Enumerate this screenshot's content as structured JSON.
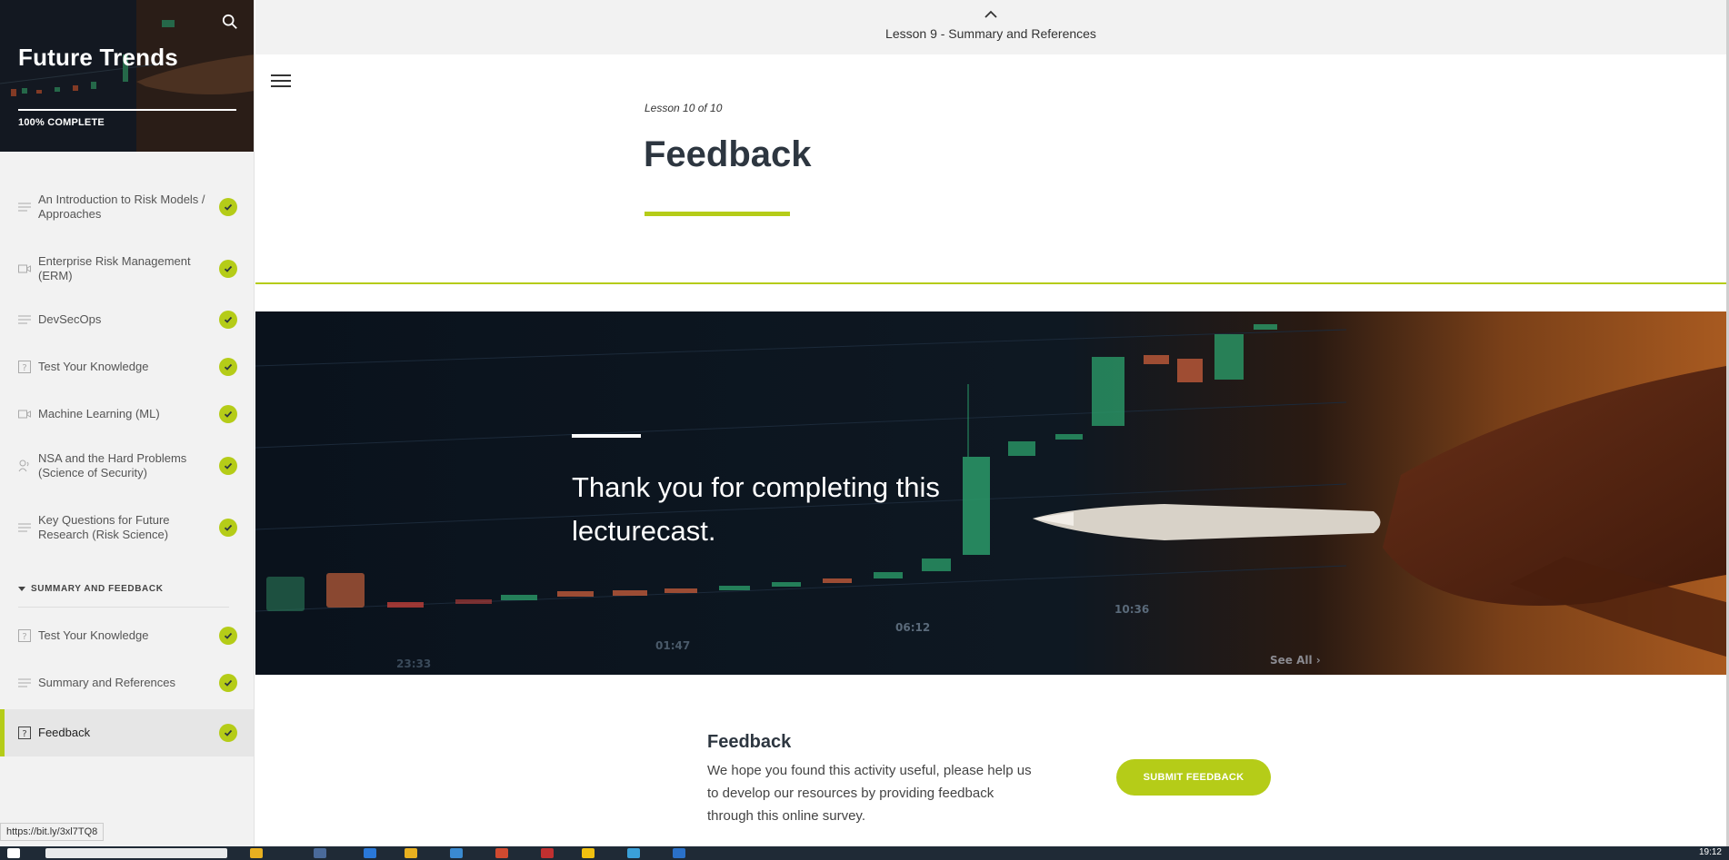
{
  "sidebar": {
    "course_title": "Future Trends",
    "progress_label": "100% COMPLETE",
    "progress_value": 1.0,
    "section_label": "SUMMARY AND FEEDBACK",
    "lessons": [
      {
        "label": "An Introduction to Risk Models / Approaches",
        "icon": "text-lines-icon",
        "complete": true
      },
      {
        "label": "Enterprise Risk Management (ERM)",
        "icon": "video-icon",
        "complete": true
      },
      {
        "label": "DevSecOps",
        "icon": "text-lines-icon",
        "complete": true
      },
      {
        "label": "Test Your Knowledge",
        "icon": "quiz-icon",
        "complete": true
      },
      {
        "label": "Machine Learning (ML)",
        "icon": "video-icon",
        "complete": true
      },
      {
        "label": "NSA and the Hard Problems (Science of Security)",
        "icon": "audio-icon",
        "complete": true
      },
      {
        "label": "Key Questions for Future Research (Risk Science)",
        "icon": "text-lines-icon",
        "complete": true
      }
    ],
    "section_lessons": [
      {
        "label": "Test Your Knowledge",
        "icon": "quiz-icon",
        "complete": true
      },
      {
        "label": "Summary and References",
        "icon": "text-lines-icon",
        "complete": true
      },
      {
        "label": "Feedback",
        "icon": "quiz-icon",
        "complete": true,
        "active": true
      }
    ]
  },
  "topbar": {
    "previous_lesson": "Lesson 9 - Summary and References"
  },
  "lesson": {
    "count": "Lesson 10 of 10",
    "title": "Feedback"
  },
  "hero": {
    "message": "Thank you for completing this lecturecast."
  },
  "feedback": {
    "title": "Feedback",
    "body": "We hope you found this activity useful, please help us to develop our resources by providing feedback through this online survey.",
    "button_label": "SUBMIT FEEDBACK"
  },
  "status_bar": {
    "url": "https://bit.ly/3xl7TQ8"
  },
  "taskbar": {
    "clock": "19:12"
  },
  "colors": {
    "accent": "#b5cc18",
    "title_text": "#2d3640",
    "sidebar_bg": "#f2f2f2"
  }
}
